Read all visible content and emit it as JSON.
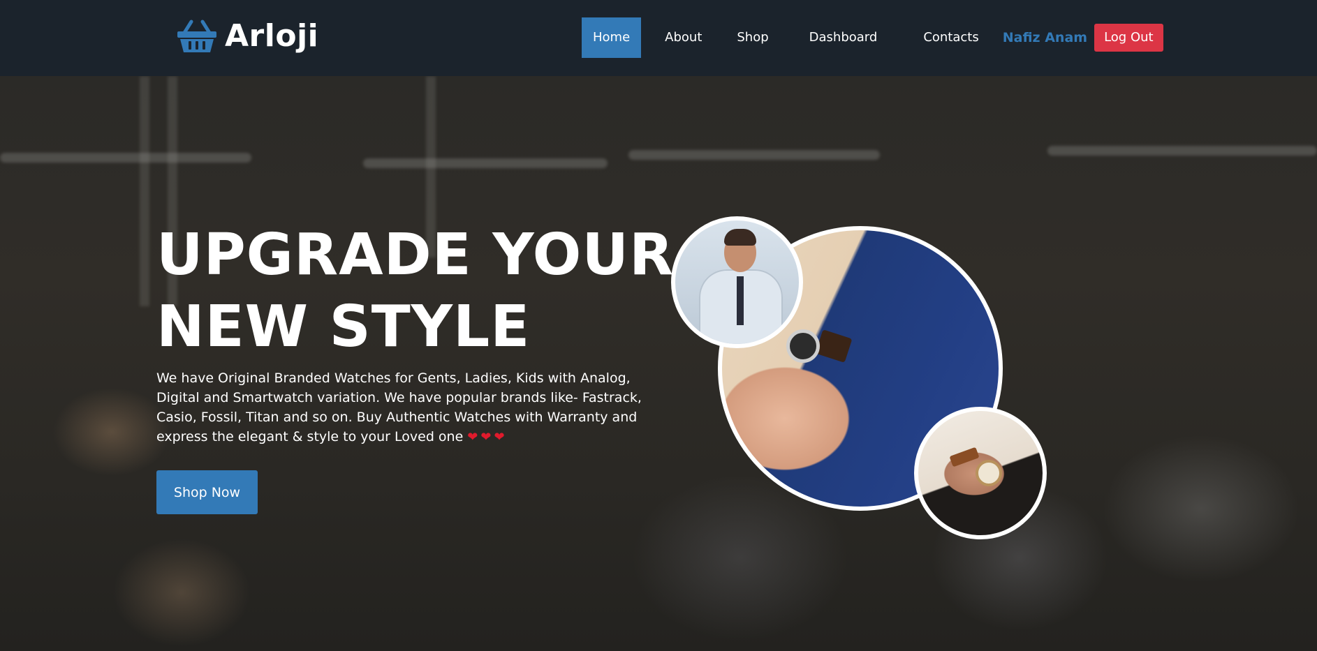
{
  "brand": {
    "name": "Arloji",
    "icon": "shopping-basket-icon",
    "accent_color": "#337ab7"
  },
  "nav": {
    "items": [
      {
        "label": "Home",
        "active": true
      },
      {
        "label": "About",
        "active": false
      },
      {
        "label": "Shop",
        "active": false
      },
      {
        "label": "Dashboard",
        "active": false
      },
      {
        "label": "Contacts",
        "active": false
      }
    ],
    "user_name": "Nafiz Anam",
    "logout_label": "Log Out",
    "logout_color": "#dc3545"
  },
  "hero": {
    "title_line_1": "UPGRADE YOUR",
    "title_line_2": "NEW STYLE",
    "description": "We have Original Branded Watches for Gents, Ladies, Kids with Analog, Digital and Smartwatch variation. We have popular brands like- Fastrack, Casio, Fossil, Titan and so on. Buy Authentic Watches with Warranty and express the elegant & style to your Loved one",
    "hearts": "❤❤❤",
    "cta_label": "Shop Now"
  }
}
